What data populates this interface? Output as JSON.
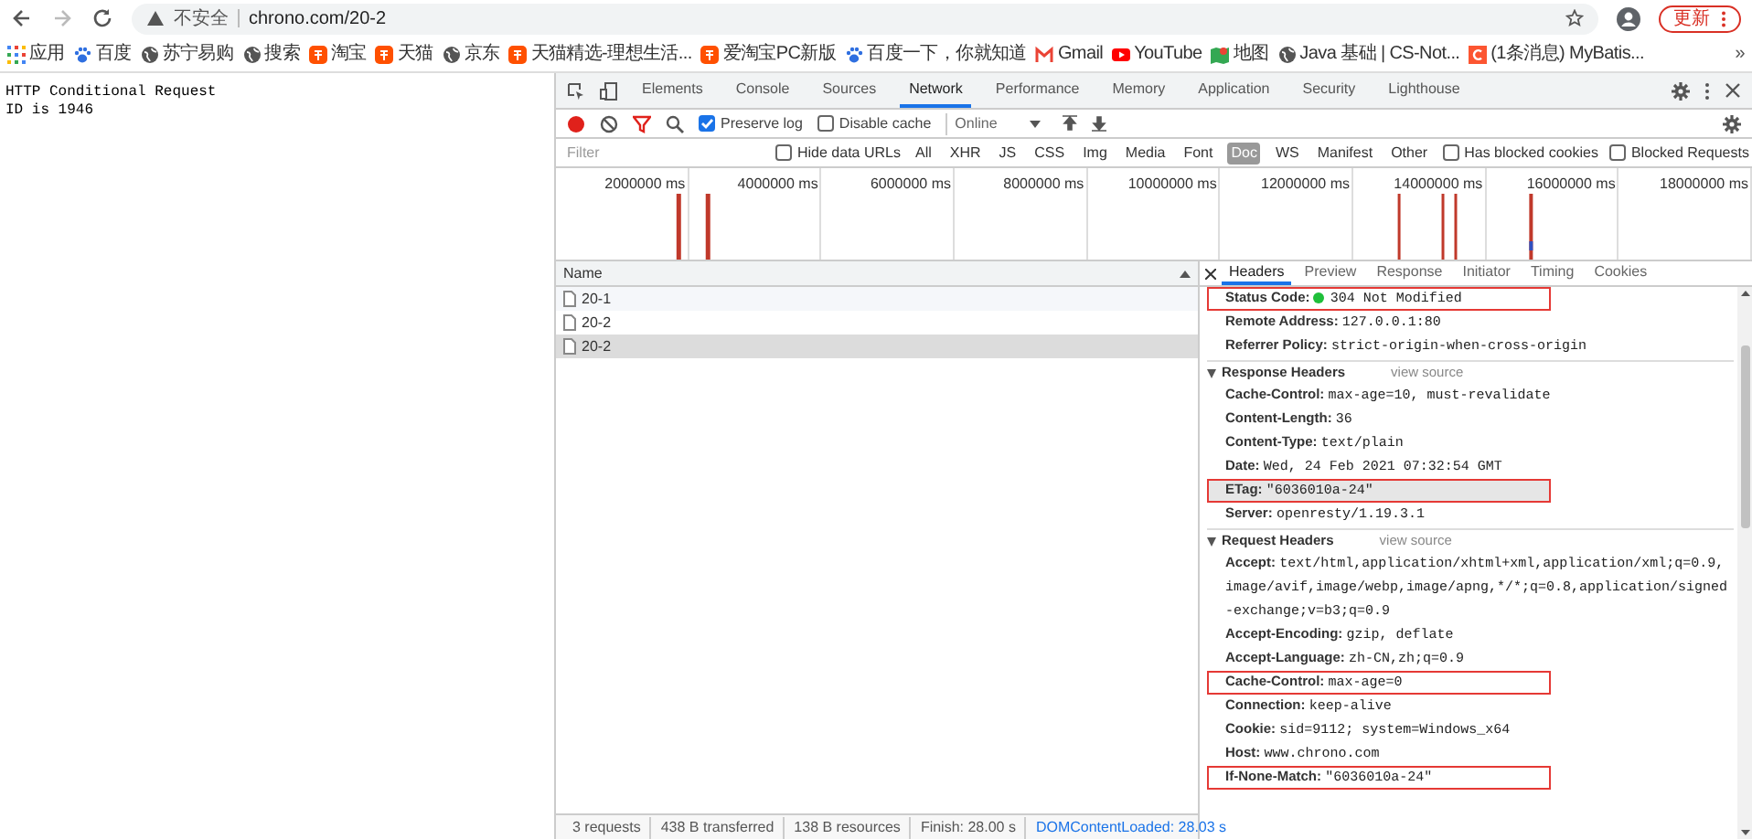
{
  "browser": {
    "address": {
      "security": "不安全",
      "url": "chrono.com/20-2"
    },
    "update_button": "更新",
    "more": "»",
    "bookmarks": [
      {
        "label": "应用"
      },
      {
        "label": "百度"
      },
      {
        "label": "苏宁易购"
      },
      {
        "label": "搜索"
      },
      {
        "label": "淘宝"
      },
      {
        "label": "天猫"
      },
      {
        "label": "京东"
      },
      {
        "label": "天猫精选-理想生活..."
      },
      {
        "label": "爱淘宝PC新版"
      },
      {
        "label": "百度一下，你就知道"
      },
      {
        "label": "Gmail"
      },
      {
        "label": "YouTube"
      },
      {
        "label": "地图"
      },
      {
        "label": "Java 基础 | CS-Not..."
      },
      {
        "label": "(1条消息) MyBatis..."
      }
    ]
  },
  "page": {
    "lines": [
      "HTTP Conditional Request",
      "ID is 1946"
    ]
  },
  "devtools": {
    "tabs": [
      {
        "label": "Elements",
        "selected": false
      },
      {
        "label": "Console",
        "selected": false
      },
      {
        "label": "Sources",
        "selected": false
      },
      {
        "label": "Network",
        "selected": true
      },
      {
        "label": "Performance",
        "selected": false
      },
      {
        "label": "Memory",
        "selected": false
      },
      {
        "label": "Application",
        "selected": false
      },
      {
        "label": "Security",
        "selected": false
      },
      {
        "label": "Lighthouse",
        "selected": false
      }
    ],
    "toolbar": {
      "recording": true,
      "preserve_log": {
        "label": "Preserve log",
        "checked": true
      },
      "disable_cache": {
        "label": "Disable cache",
        "checked": false
      },
      "throttle": "Online"
    },
    "filter": {
      "placeholder": "Filter",
      "hide_data_urls": {
        "label": "Hide data URLs",
        "checked": false
      },
      "types": [
        {
          "label": "All",
          "selected": false
        },
        {
          "label": "XHR",
          "selected": false
        },
        {
          "label": "JS",
          "selected": false
        },
        {
          "label": "CSS",
          "selected": false
        },
        {
          "label": "Img",
          "selected": false
        },
        {
          "label": "Media",
          "selected": false
        },
        {
          "label": "Font",
          "selected": false
        },
        {
          "label": "Doc",
          "selected": true
        },
        {
          "label": "WS",
          "selected": false
        },
        {
          "label": "Manifest",
          "selected": false
        },
        {
          "label": "Other",
          "selected": false
        }
      ],
      "blocked_cookies": {
        "label": "Has blocked cookies",
        "checked": false
      },
      "blocked_requests": {
        "label": "Blocked Requests",
        "checked": false
      }
    },
    "timeline": {
      "ticks": [
        "2000000 ms",
        "4000000 ms",
        "6000000 ms",
        "8000000 ms",
        "10000000 ms",
        "12000000 ms",
        "14000000 ms",
        "16000000 ms",
        "18000000 ms"
      ]
    },
    "requests": {
      "column": "Name",
      "rows": [
        {
          "name": "20-1",
          "selected": false
        },
        {
          "name": "20-2",
          "selected": false
        },
        {
          "name": "20-2",
          "selected": true
        }
      ]
    },
    "status_bar": [
      {
        "text": "3 requests",
        "kind": "plain"
      },
      {
        "text": "438 B transferred",
        "kind": "plain"
      },
      {
        "text": "138 B resources",
        "kind": "plain"
      },
      {
        "text": "Finish: 28.00 s",
        "kind": "plain"
      },
      {
        "text": "DOMContentLoaded: 28.03 s",
        "kind": "load"
      }
    ],
    "detail_tabs": [
      {
        "label": "Headers",
        "selected": true
      },
      {
        "label": "Preview",
        "selected": false
      },
      {
        "label": "Response",
        "selected": false
      },
      {
        "label": "Initiator",
        "selected": false
      },
      {
        "label": "Timing",
        "selected": false
      },
      {
        "label": "Cookies",
        "selected": false
      }
    ],
    "general": [
      {
        "name": "Status Code:",
        "value": "304 Not Modified",
        "color": "#1fbf3a",
        "highlighted": true,
        "selected": false
      },
      {
        "name": "Remote Address:",
        "value": "127.0.0.1:80",
        "highlighted": false,
        "selected": false
      },
      {
        "name": "Referrer Policy:",
        "value": "strict-origin-when-cross-origin",
        "highlighted": false,
        "selected": false
      }
    ],
    "sections": [
      {
        "title": "Response Headers",
        "view_source": "view source",
        "expanded": true,
        "rows": [
          {
            "name": "Cache-Control:",
            "value": "max-age=10, must-revalidate",
            "highlighted": false,
            "selected": false
          },
          {
            "name": "Content-Length:",
            "value": "36",
            "highlighted": false,
            "selected": false
          },
          {
            "name": "Content-Type:",
            "value": "text/plain",
            "highlighted": false,
            "selected": false
          },
          {
            "name": "Date:",
            "value": "Wed, 24 Feb 2021 07:32:54 GMT",
            "highlighted": false,
            "selected": false
          },
          {
            "name": "ETag:",
            "value": "\"6036010a-24\"",
            "highlighted": true,
            "selected": true
          },
          {
            "name": "Server:",
            "value": "openresty/1.19.3.1",
            "highlighted": false,
            "selected": false
          }
        ]
      },
      {
        "title": "Request Headers",
        "view_source": "view source",
        "expanded": true,
        "rows": [
          {
            "name": "Accept:",
            "value": "text/html,application/xhtml+xml,application/xml;q=0.9,image/avif,image/webp,image/apng,*/*;q=0.8,application/signed-exchange;v=b3;q=0.9",
            "highlighted": false,
            "selected": false
          },
          {
            "name": "Accept-Encoding:",
            "value": "gzip, deflate",
            "highlighted": false,
            "selected": false
          },
          {
            "name": "Accept-Language:",
            "value": "zh-CN,zh;q=0.9",
            "highlighted": false,
            "selected": false
          },
          {
            "name": "Cache-Control:",
            "value": "max-age=0",
            "highlighted": true,
            "selected": false
          },
          {
            "name": "Connection:",
            "value": "keep-alive",
            "highlighted": false,
            "selected": false
          },
          {
            "name": "Cookie:",
            "value": "sid=9112; system=Windows_x64",
            "highlighted": false,
            "selected": false
          },
          {
            "name": "Host:",
            "value": "www.chrono.com",
            "highlighted": false,
            "selected": false
          },
          {
            "name": "If-None-Match:",
            "value": "\"6036010a-24\"",
            "highlighted": true,
            "selected": false
          }
        ]
      }
    ]
  }
}
